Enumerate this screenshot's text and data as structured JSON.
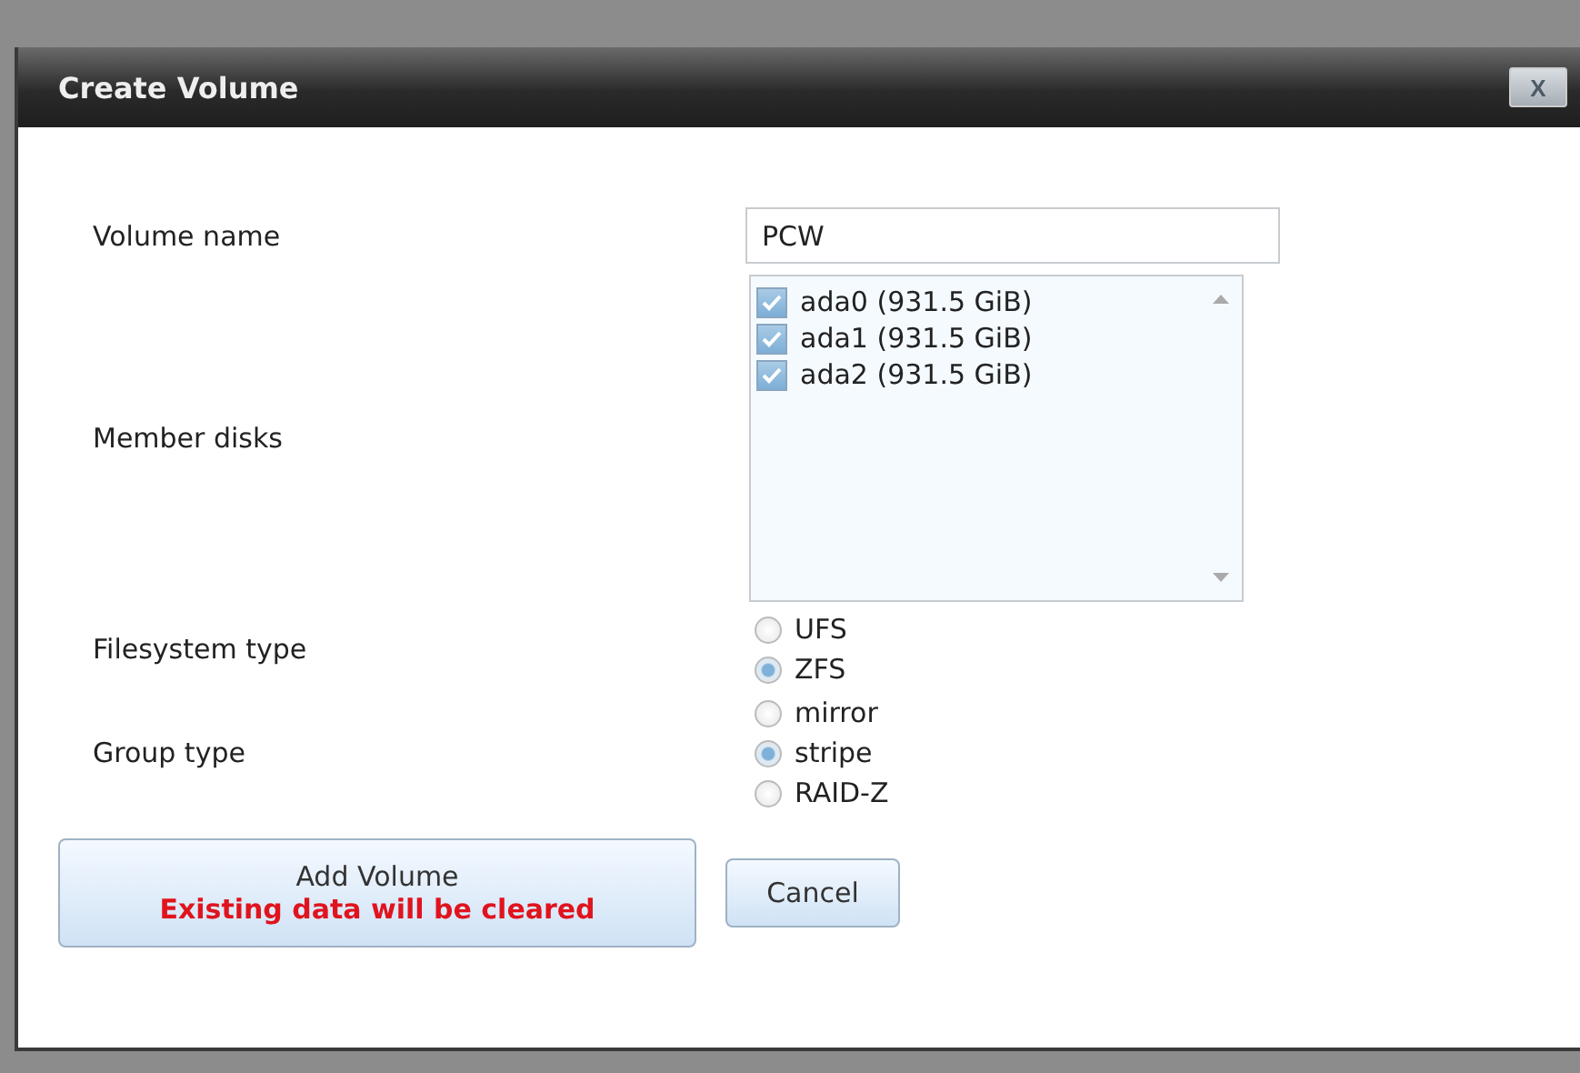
{
  "dialog": {
    "title": "Create Volume",
    "close_label": "X"
  },
  "volume_name": {
    "label": "Volume name",
    "value": "PCW"
  },
  "member_disks": {
    "label": "Member disks",
    "items": [
      {
        "label": "ada0 (931.5 GiB)",
        "checked": true
      },
      {
        "label": "ada1 (931.5 GiB)",
        "checked": true
      },
      {
        "label": "ada2 (931.5 GiB)",
        "checked": true
      }
    ]
  },
  "filesystem_type": {
    "label": "Filesystem type",
    "options": [
      {
        "label": "UFS",
        "selected": false
      },
      {
        "label": "ZFS",
        "selected": true
      }
    ]
  },
  "group_type": {
    "label": "Group type",
    "options": [
      {
        "label": "mirror",
        "selected": false
      },
      {
        "label": "stripe",
        "selected": true
      },
      {
        "label": "RAID-Z",
        "selected": false
      }
    ]
  },
  "buttons": {
    "add": {
      "label": "Add Volume",
      "warning": "Existing data will be cleared"
    },
    "cancel": {
      "label": "Cancel"
    }
  }
}
